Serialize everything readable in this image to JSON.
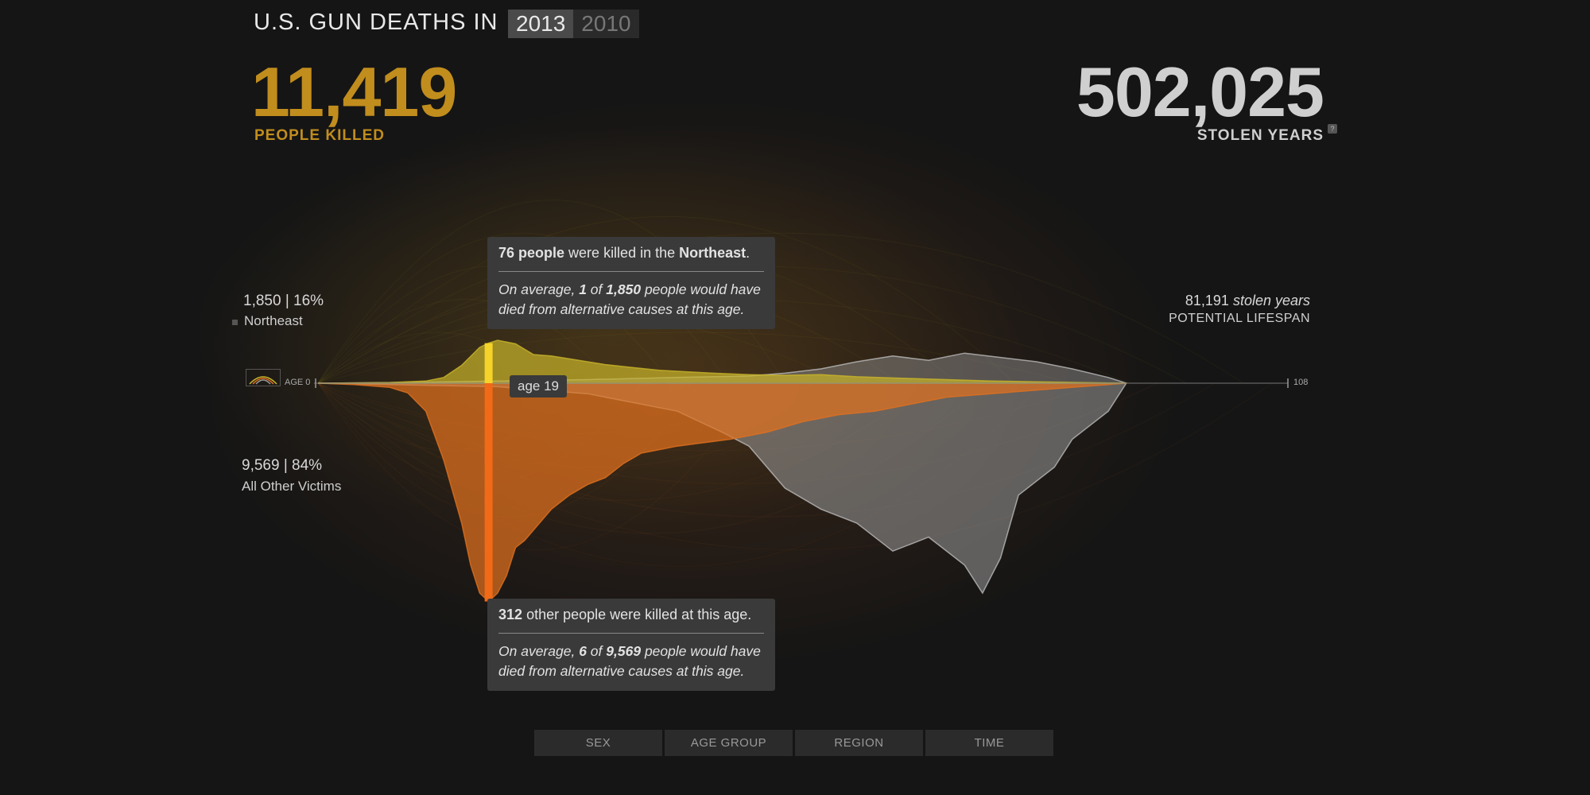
{
  "header": {
    "title": "U.S. GUN DEATHS IN",
    "years": [
      {
        "label": "2013",
        "active": true
      },
      {
        "label": "2010",
        "active": false
      }
    ]
  },
  "stats": {
    "killed_value": "11,419",
    "killed_label": "PEOPLE KILLED",
    "stolen_value": "502,025",
    "stolen_label": "STOLEN YEARS",
    "help_label": "?"
  },
  "groups": {
    "top": {
      "summary": "1,850 | 16%",
      "name": "Northeast"
    },
    "bottom": {
      "summary": "9,569 | 84%",
      "name": "All Other Victims"
    }
  },
  "potential": {
    "value": "81,191",
    "suffix": "stolen years",
    "label": "POTENTIAL LIFESPAN"
  },
  "axis": {
    "start_label": "AGE 0",
    "end_label": "108"
  },
  "selection": {
    "age_label": "age 19"
  },
  "tooltip_top": {
    "count": "76 people",
    "mid": "were killed in the",
    "region": "Northeast",
    "end": ".",
    "avg_pre": "On average,",
    "avg_num": "1",
    "avg_of": "of",
    "avg_total": "1,850",
    "avg_post": "people would have died from alternative causes at this age."
  },
  "tooltip_bottom": {
    "count": "312",
    "mid": "other people were killed at this age.",
    "avg_pre": "On average,",
    "avg_num": "6",
    "avg_of": "of",
    "avg_total": "9,569",
    "avg_post": "people would have died from alternative causes at this age."
  },
  "tabs": [
    "SEX",
    "AGE GROUP",
    "REGION",
    "TIME"
  ],
  "colors": {
    "background": "#151515",
    "northeast": "#c9b52a",
    "others": "#e0701f",
    "stolen": "#9a9a9a",
    "highlight_top": "#f5d32a",
    "highlight_bottom": "#f06a17",
    "accent": "#c18d1d"
  },
  "chart_data": {
    "type": "area",
    "x_label": "",
    "xlim": [
      0,
      108
    ],
    "selected_age": 19,
    "series": [
      {
        "name": "Northeast",
        "side": "top",
        "x": [
          0,
          4,
          8,
          12,
          14,
          16,
          18,
          19,
          20,
          22,
          24,
          26,
          28,
          30,
          32,
          35,
          38,
          41,
          44,
          48,
          52,
          56,
          60,
          65,
          70,
          75,
          80,
          85,
          90
        ],
        "values": [
          0,
          0.5,
          1,
          3,
          8,
          25,
          50,
          56,
          60,
          55,
          40,
          38,
          34,
          30,
          26,
          22,
          18,
          16,
          14,
          12,
          11,
          12,
          9,
          7,
          5,
          3,
          2,
          1,
          0
        ]
      },
      {
        "name": "All Other Victims",
        "side": "bottom",
        "x": [
          0,
          4,
          8,
          10,
          12,
          14,
          16,
          17,
          18,
          19,
          20,
          21,
          22,
          23,
          24,
          26,
          28,
          30,
          32,
          34,
          36,
          38,
          40,
          43,
          46,
          50,
          54,
          58,
          62,
          66,
          70,
          75,
          80,
          85,
          90
        ],
        "values": [
          0,
          2,
          6,
          14,
          40,
          110,
          200,
          260,
          300,
          312,
          300,
          275,
          235,
          225,
          210,
          180,
          160,
          145,
          135,
          115,
          100,
          95,
          90,
          85,
          80,
          70,
          55,
          45,
          40,
          30,
          20,
          15,
          10,
          5,
          0
        ]
      },
      {
        "name": "Stolen years (top)",
        "side": "top",
        "x": [
          0,
          10,
          20,
          30,
          40,
          48,
          52,
          56,
          60,
          64,
          68,
          72,
          76,
          80,
          84,
          88,
          90
        ],
        "values": [
          0,
          1,
          3,
          5,
          8,
          10,
          14,
          20,
          30,
          38,
          32,
          42,
          36,
          30,
          20,
          8,
          0
        ]
      },
      {
        "name": "Stolen years (bottom)",
        "side": "bottom",
        "x": [
          0,
          20,
          30,
          40,
          45,
          48,
          52,
          56,
          60,
          64,
          68,
          72,
          74,
          76,
          78,
          80,
          82,
          84,
          86,
          88,
          90
        ],
        "values": [
          0,
          5,
          15,
          40,
          70,
          90,
          150,
          180,
          200,
          240,
          220,
          260,
          300,
          250,
          160,
          140,
          120,
          80,
          60,
          40,
          0
        ]
      }
    ]
  }
}
